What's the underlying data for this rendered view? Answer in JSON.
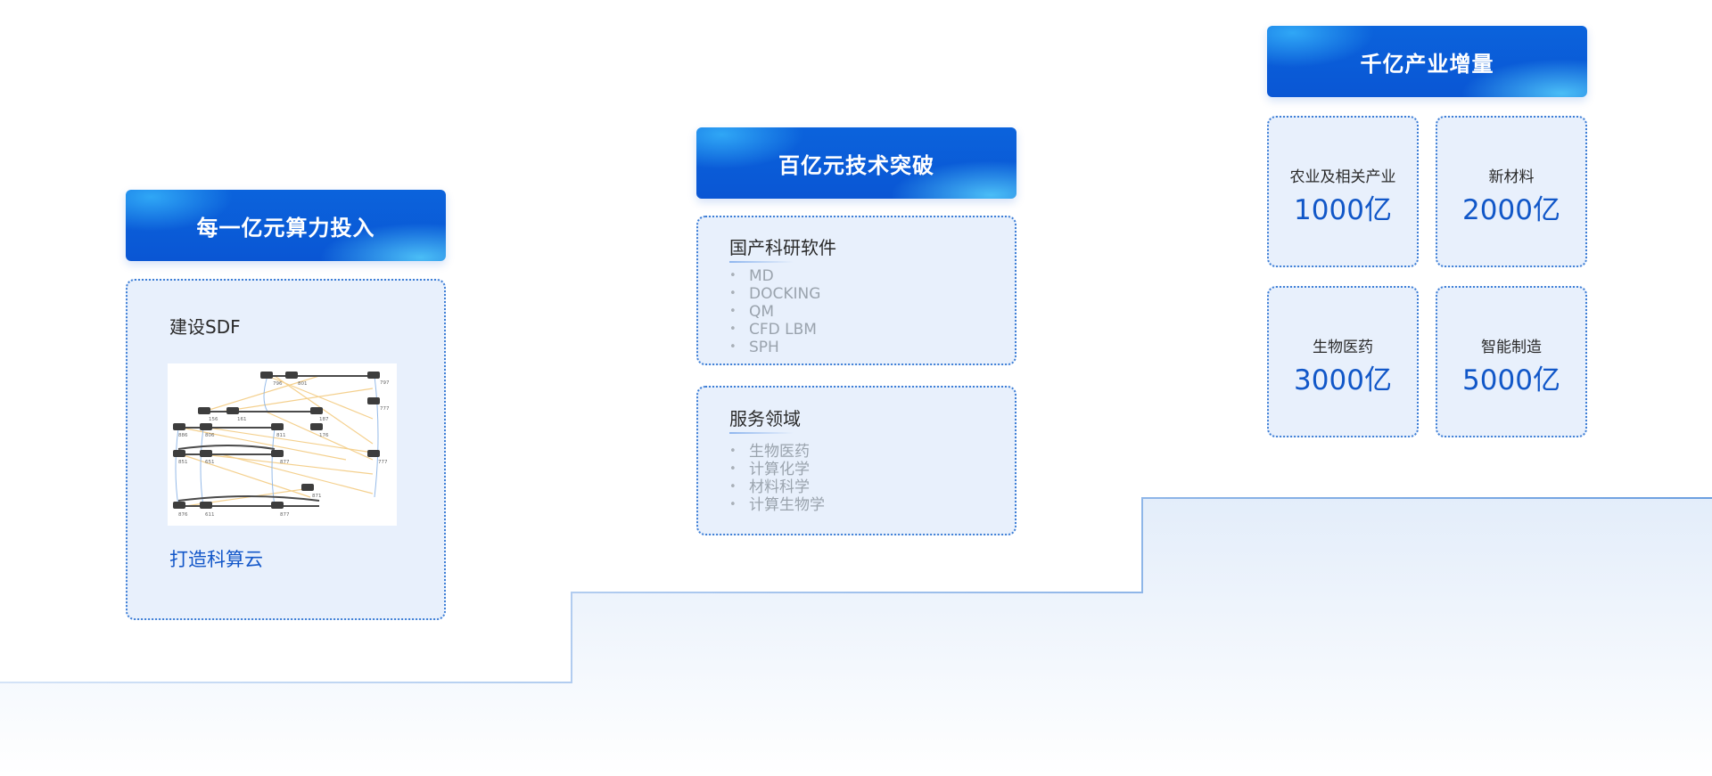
{
  "column1": {
    "header": "每一亿元算力投入",
    "title": "建设SDF",
    "image_alt": "SDF network topology diagram",
    "node_labels": [
      "796",
      "801",
      "156",
      "161",
      "187",
      "886",
      "806",
      "811",
      "176",
      "851",
      "651",
      "877",
      "177",
      "816",
      "611",
      "871",
      "177",
      "777",
      "876"
    ],
    "link": "打造科算云"
  },
  "column2": {
    "header": "百亿元技术突破",
    "software": {
      "title": "国产科研软件",
      "items": [
        "MD",
        "DOCKING",
        "QM",
        "CFD LBM",
        "SPH"
      ]
    },
    "services": {
      "title": "服务领域",
      "items": [
        "生物医药",
        "计算化学",
        "材料科学",
        "计算生物学"
      ]
    }
  },
  "column3": {
    "header": "千亿产业增量",
    "cards": [
      {
        "label": "农业及相关产业",
        "value": "1000亿"
      },
      {
        "label": "新材料",
        "value": "2000亿"
      },
      {
        "label": "生物医药",
        "value": "3000亿"
      },
      {
        "label": "智能制造",
        "value": "5000亿"
      }
    ]
  },
  "colors": {
    "accent": "#0a56d4",
    "accent_light": "#5ad7ff",
    "panel_bg": "#e8f0fc",
    "panel_border": "#3f7fd6",
    "value_text": "#1157c8",
    "list_text": "#9aa3ad"
  }
}
